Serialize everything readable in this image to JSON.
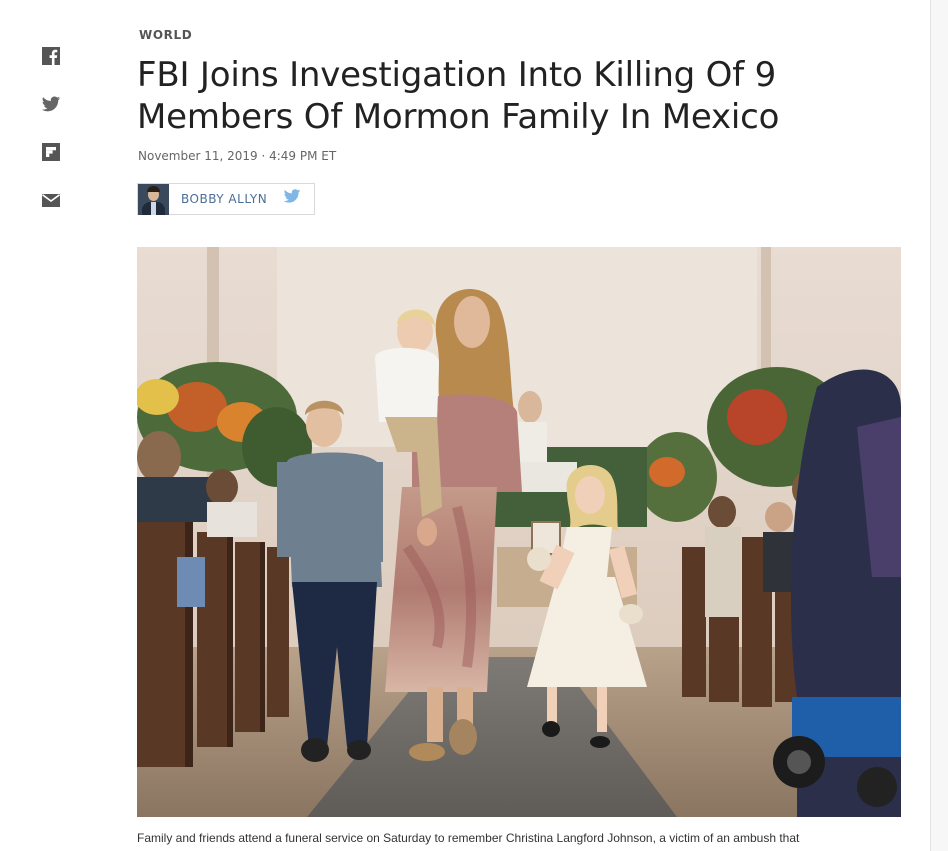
{
  "share": {
    "icons": [
      "facebook-icon",
      "twitter-icon",
      "flipboard-icon",
      "email-icon"
    ],
    "icon_color": "#555555"
  },
  "article": {
    "section": "WORLD",
    "headline": "FBI Joins Investigation Into Killing Of 9 Members Of Mormon Family In Mexico",
    "dateline": "November 11, 2019 · 4:49 PM ET",
    "author": "BOBBY ALLYN",
    "author_color": "#4a6f97",
    "twitter_color": "#7fb6e6",
    "caption": "Family and friends attend a funeral service on Saturday to remember Christina Langford Johnson, a victim of an ambush that"
  }
}
